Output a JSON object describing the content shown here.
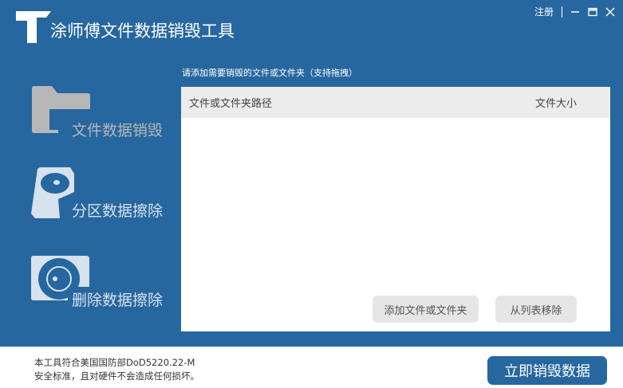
{
  "app": {
    "title": "涂师傅文件数据销毁工具",
    "register": "注册"
  },
  "nav": [
    {
      "label": "文件数据销毁",
      "icon": "folder-icon",
      "active": true
    },
    {
      "label": "分区数据擦除",
      "icon": "hard-drive-icon"
    },
    {
      "label": "删除数据擦除",
      "icon": "disc-erase-icon"
    }
  ],
  "main": {
    "hint": "请添加需要销毁的文件或文件夹（支持拖拽）",
    "columns": [
      "文件或文件夹路径",
      "文件大小"
    ],
    "rows": [],
    "add_button": "添加文件或文件夹",
    "remove_button": "从列表移除"
  },
  "footer": {
    "line1": "本工具符合美国国防部DoD5220.22-M",
    "line2": "安全标准，且对硬件不会造成任何损坏。",
    "start_button": "立即销毁数据"
  },
  "colors": {
    "primary": "#27679f"
  }
}
